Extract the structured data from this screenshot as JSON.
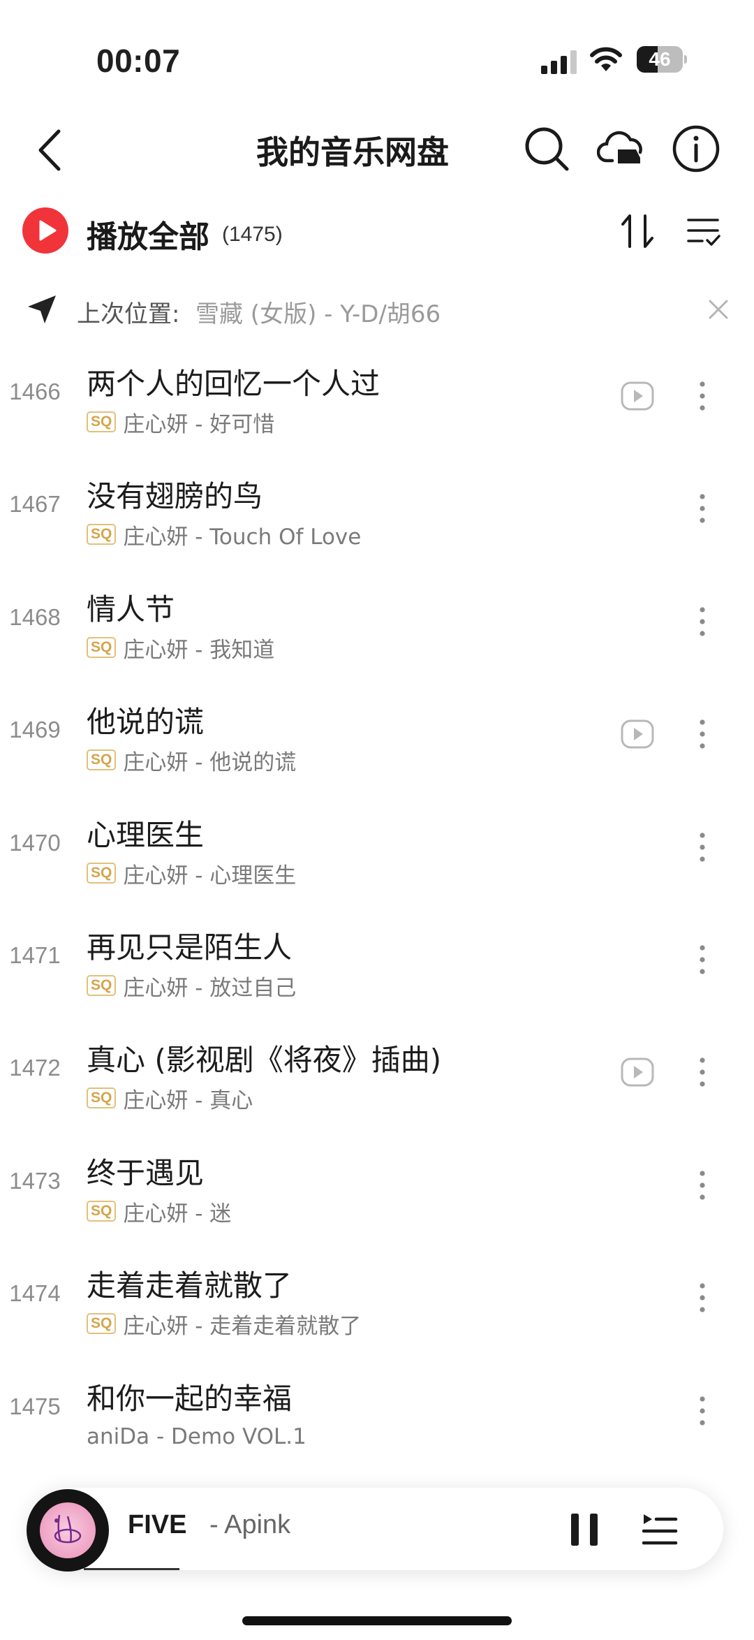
{
  "status_bar": {
    "time": "00:07",
    "battery_level": "46",
    "battery_fraction": 0.46
  },
  "nav": {
    "title": "我的音乐网盘",
    "icons": [
      "back-icon",
      "search-icon",
      "cloud-upload-icon",
      "info-icon"
    ]
  },
  "play_all": {
    "label": "播放全部",
    "count": "(1475)",
    "icons": [
      "play-icon",
      "sort-icon",
      "multi-select-icon"
    ]
  },
  "last_position": {
    "label": "上次位置:",
    "value": "雪藏 (女版) - Y-D/胡66"
  },
  "songs": [
    {
      "index": "1466",
      "title": "两个人的回忆一个人过",
      "sq": "SQ",
      "subtitle": "庄心妍 - 好可惜",
      "has_sq": true,
      "has_mv": true
    },
    {
      "index": "1467",
      "title": "没有翅膀的鸟",
      "sq": "SQ",
      "subtitle": "庄心妍 - Touch Of Love",
      "has_sq": true,
      "has_mv": false
    },
    {
      "index": "1468",
      "title": "情人节",
      "sq": "SQ",
      "subtitle": "庄心妍 - 我知道",
      "has_sq": true,
      "has_mv": false
    },
    {
      "index": "1469",
      "title": "他说的谎",
      "sq": "SQ",
      "subtitle": "庄心妍 - 他说的谎",
      "has_sq": true,
      "has_mv": true
    },
    {
      "index": "1470",
      "title": "心理医生",
      "sq": "SQ",
      "subtitle": "庄心妍 - 心理医生",
      "has_sq": true,
      "has_mv": false
    },
    {
      "index": "1471",
      "title": "再见只是陌生人",
      "sq": "SQ",
      "subtitle": "庄心妍 - 放过自己",
      "has_sq": true,
      "has_mv": false
    },
    {
      "index": "1472",
      "title": "真心 (影视剧《将夜》插曲)",
      "sq": "SQ",
      "subtitle": "庄心妍 - 真心",
      "has_sq": true,
      "has_mv": true
    },
    {
      "index": "1473",
      "title": "终于遇见",
      "sq": "SQ",
      "subtitle": "庄心妍 - 迷",
      "has_sq": true,
      "has_mv": false
    },
    {
      "index": "1474",
      "title": "走着走着就散了",
      "sq": "SQ",
      "subtitle": "庄心妍 - 走着走着就散了",
      "has_sq": true,
      "has_mv": false
    },
    {
      "index": "1475",
      "title": "和你一起的幸福",
      "sq": "",
      "subtitle": "aniDa - Demo VOL.1",
      "has_sq": false,
      "has_mv": false
    }
  ],
  "player": {
    "song": "FIVE",
    "artist": "- Apink",
    "progress": 0.15,
    "icons": [
      "album-art",
      "pause-icon",
      "queue-icon"
    ]
  },
  "colors": {
    "accent": "#f0343a",
    "sq_badge": "#d4a54a",
    "index_gray": "#8c8c8c",
    "subtitle_gray": "#7a7a7a"
  }
}
